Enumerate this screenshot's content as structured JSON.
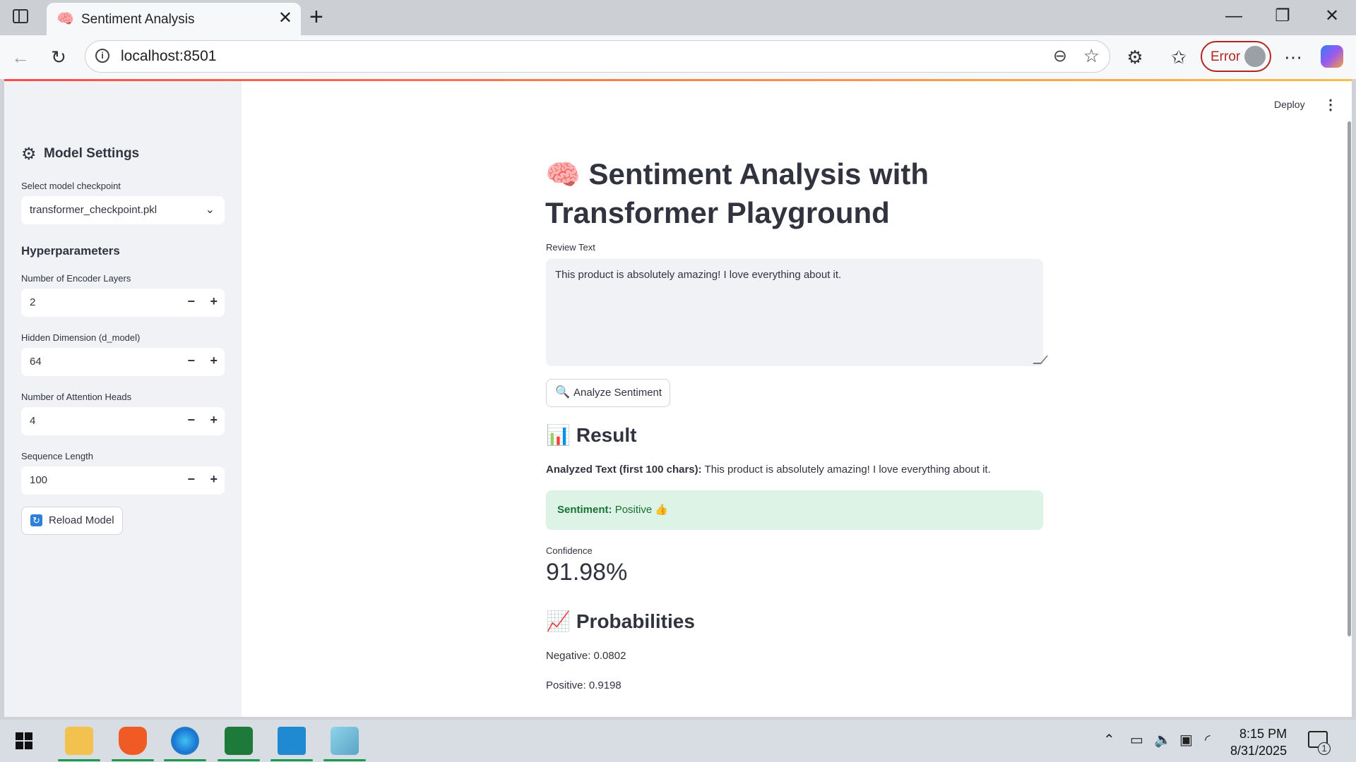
{
  "browser": {
    "tab_title": "Sentiment Analysis",
    "tab_favicon": "🧠",
    "url": "localhost:8501",
    "error_label": "Error"
  },
  "app": {
    "deploy_label": "Deploy",
    "sidebar": {
      "settings_title": "Model Settings",
      "checkpoint_label": "Select model checkpoint",
      "checkpoint_value": "transformer_checkpoint.pkl",
      "hyper_title": "Hyperparameters",
      "encoder_layers_label": "Number of Encoder Layers",
      "encoder_layers_value": "2",
      "hidden_dim_label": "Hidden Dimension (d_model)",
      "hidden_dim_value": "64",
      "attention_heads_label": "Number of Attention Heads",
      "attention_heads_value": "4",
      "seq_len_label": "Sequence Length",
      "seq_len_value": "100",
      "reload_label": "Reload Model"
    },
    "main": {
      "title_emoji": "🧠",
      "title": "Sentiment Analysis with Transformer Playground",
      "review_label": "Review Text",
      "review_text": "This product is absolutely amazing! I love everything about it.",
      "analyze_label": "Analyze Sentiment",
      "result_emoji": "📊",
      "result_title": "Result",
      "analyzed_prefix": "Analyzed Text (first 100 chars):",
      "analyzed_text": "This product is absolutely amazing! I love everything about it.",
      "sentiment_prefix": "Sentiment:",
      "sentiment_value": "Positive 👍",
      "confidence_label": "Confidence",
      "confidence_value": "91.98%",
      "prob_emoji": "📈",
      "prob_title": "Probabilities",
      "negative": "Negative: 0.0802",
      "positive": "Positive: 0.9198"
    }
  },
  "taskbar": {
    "time": "8:15 PM",
    "date": "8/31/2025",
    "notification_count": "1"
  }
}
